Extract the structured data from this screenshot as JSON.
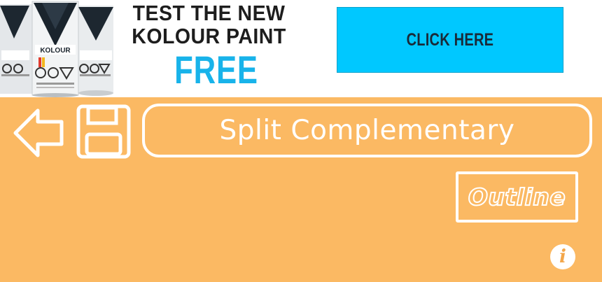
{
  "ad": {
    "headline_line1": "TEST THE NEW",
    "headline_line2": "KOLOUR PAINT",
    "free": "FREE",
    "cta_label": "CLICK HERE",
    "can_brand": "KOLOUR",
    "colors": {
      "cta_bg": "#00c8ff",
      "free_text": "#18b3ea"
    }
  },
  "toolbar": {
    "title": "Split Complementary",
    "back_icon": "back-arrow-icon",
    "save_icon": "floppy-disk-icon"
  },
  "outline_label": "Outline",
  "info_glyph": "i",
  "colors": {
    "background": "#fbb963",
    "foreground": "#ffffff"
  }
}
